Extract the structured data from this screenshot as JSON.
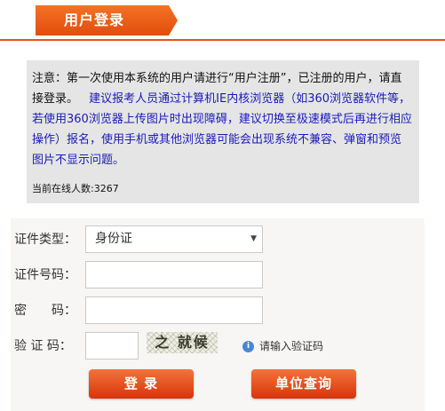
{
  "header": {
    "tab_title": "用户登录"
  },
  "notice": {
    "line_black": "注意：第一次使用本系统的用户请进行“用户注册”，已注册的用户，请直接登录。",
    "line_blue": "建议报考人员通过计算机IE内核浏览器（如360浏览器软件等，若使用360浏览器上传图片时出现障碍，建议切换至极速模式后再进行相应操作）报名，使用手机或其他浏览器可能会出现系统不兼容、弹窗和预览图片不显示问题。",
    "online_count": "当前在线人数:3267"
  },
  "form": {
    "id_type_label": "证件类型：",
    "id_type_value": "身份证",
    "id_number_label": "证件号码：",
    "id_number_value": "",
    "password_label": "密　　码：",
    "password_value": "",
    "captcha_label": "验 证 码：",
    "captcha_value": "",
    "captcha_image_text": "之 就候",
    "captcha_hint": "请输入验证码"
  },
  "buttons": {
    "login": "登  录",
    "unit_query": "单位查询"
  },
  "icons": {
    "select_arrow": "dropdown-arrow-icon",
    "info": "info-icon"
  },
  "colors": {
    "accent": "#e24d0e",
    "link_blue": "#1a1ab8",
    "notice_bg": "#e5e5e5"
  }
}
